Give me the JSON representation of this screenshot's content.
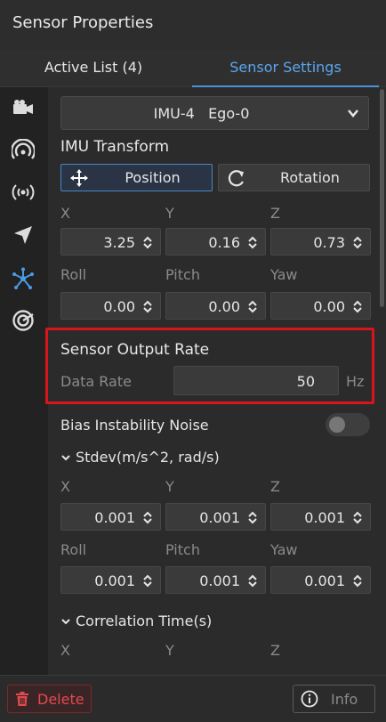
{
  "window": {
    "title": "Sensor Properties"
  },
  "tabs": [
    {
      "label": "Active List",
      "count": "(4)",
      "active": false
    },
    {
      "label": "Sensor Settings",
      "active": true
    }
  ],
  "sidebar": {
    "icons": [
      "camera-icon",
      "radar-icon",
      "broadcast-icon",
      "navigation-arrow-icon",
      "imu-star-icon",
      "target-sensor-icon"
    ],
    "active_icon": "imu-star-icon"
  },
  "sensor_select": {
    "value": "IMU-4   Ego-0"
  },
  "imu_transform": {
    "title": "IMU Transform",
    "position_label": "Position",
    "rotation_label": "Rotation",
    "position": {
      "labels": [
        "X",
        "Y",
        "Z"
      ],
      "values": [
        "3.25",
        "0.16",
        "0.73"
      ]
    },
    "rotation": {
      "labels": [
        "Roll",
        "Pitch",
        "Yaw"
      ],
      "values": [
        "0.00",
        "0.00",
        "0.00"
      ]
    }
  },
  "output_rate": {
    "title": "Sensor Output Rate",
    "label": "Data Rate",
    "value": "50",
    "unit": "Hz"
  },
  "bias_noise": {
    "title": "Bias Instability Noise",
    "enabled": false,
    "stdev": {
      "title": "Stdev(m/s^2, rad/s)",
      "xyz_labels": [
        "X",
        "Y",
        "Z"
      ],
      "xyz_values": [
        "0.001",
        "0.001",
        "0.001"
      ],
      "rpy_labels": [
        "Roll",
        "Pitch",
        "Yaw"
      ],
      "rpy_values": [
        "0.001",
        "0.001",
        "0.001"
      ]
    },
    "correlation": {
      "title": "Correlation Time(s)",
      "xyz_labels": [
        "X",
        "Y",
        "Z"
      ]
    }
  },
  "footer": {
    "delete_label": "Delete",
    "info_label": "Info"
  },
  "colors": {
    "accent": "#4a92dc",
    "highlight": "#d8141c",
    "danger": "#e34a4f"
  }
}
